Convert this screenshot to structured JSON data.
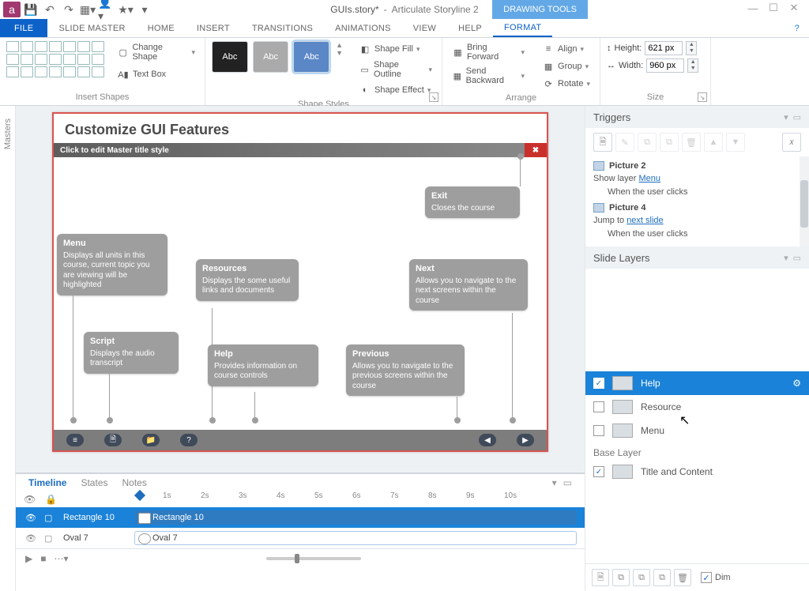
{
  "qat": {
    "app": "a"
  },
  "title": {
    "filename": "GUIs.story*",
    "appname": "Articulate Storyline 2"
  },
  "contextTab": "DRAWING TOOLS",
  "tabs": {
    "file": "FILE",
    "slideMaster": "SLIDE MASTER",
    "home": "HOME",
    "insert": "INSERT",
    "transitions": "TRANSITIONS",
    "animations": "ANIMATIONS",
    "view": "VIEW",
    "help": "HELP",
    "format": "FORMAT"
  },
  "ribbon": {
    "insertShapes": {
      "label": "Insert Shapes",
      "changeShape": "Change Shape",
      "textBox": "Text Box"
    },
    "shapeStyles": {
      "label": "Shape Styles",
      "tile": "Abc",
      "fill": "Shape Fill",
      "outline": "Shape Outline",
      "effect": "Shape Effect"
    },
    "arrange": {
      "label": "Arrange",
      "bringForward": "Bring Forward",
      "sendBackward": "Send Backward",
      "align": "Align",
      "group": "Group",
      "rotate": "Rotate"
    },
    "size": {
      "label": "Size",
      "heightLabel": "Height:",
      "height": "621 px",
      "widthLabel": "Width:",
      "width": "960 px"
    }
  },
  "sideTab": "Masters",
  "slide": {
    "heading": "Customize GUI Features",
    "prompt": "Click to edit Master title style",
    "callouts": {
      "exit": {
        "t": "Exit",
        "b": "Closes the course"
      },
      "menu": {
        "t": "Menu",
        "b": "Displays all units in this course, current topic you are viewing will be highlighted"
      },
      "resources": {
        "t": "Resources",
        "b": "Displays the some useful links and documents"
      },
      "next": {
        "t": "Next",
        "b": "Allows you to navigate to the next screens within the course"
      },
      "script": {
        "t": "Script",
        "b": "Displays the audio transcript"
      },
      "help": {
        "t": "Help",
        "b": "Provides information on course controls"
      },
      "previous": {
        "t": "Previous",
        "b": "Allows you to navigate to the previous screens within the course"
      }
    }
  },
  "bottom": {
    "tabs": {
      "timeline": "Timeline",
      "states": "States",
      "notes": "Notes"
    },
    "ticks": [
      "1s",
      "2s",
      "3s",
      "4s",
      "5s",
      "6s",
      "7s",
      "8s",
      "9s",
      "10s"
    ],
    "rows": {
      "rect": "Rectangle 10",
      "oval": "Oval 7"
    }
  },
  "triggers": {
    "title": "Triggers",
    "obj1": "Picture 2",
    "t1a": "Show layer ",
    "t1link": "Menu",
    "t1b": "When the user clicks",
    "obj2": "Picture 4",
    "t2a": "Jump to ",
    "t2link": "next slide",
    "t2b": "When the user clicks"
  },
  "layers": {
    "title": "Slide Layers",
    "items": {
      "help": "Help",
      "resource": "Resource",
      "menu": "Menu"
    },
    "baseLabel": "Base Layer",
    "baseItem": "Title and Content",
    "dim": "Dim"
  }
}
